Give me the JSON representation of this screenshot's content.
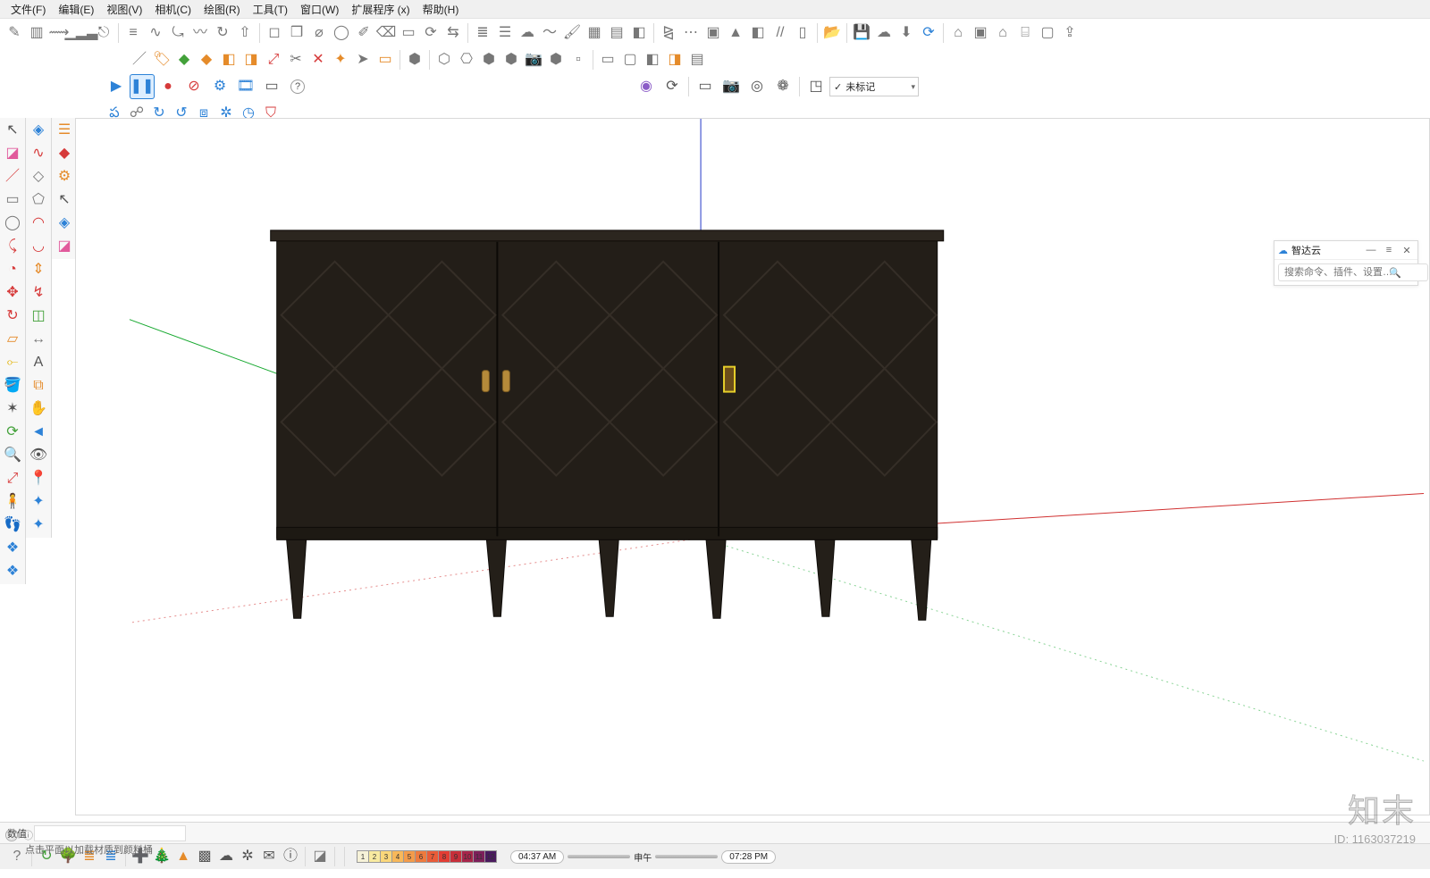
{
  "menubar": {
    "items": [
      "文件(F)",
      "编辑(E)",
      "视图(V)",
      "相机(C)",
      "绘图(R)",
      "工具(T)",
      "窗口(W)",
      "扩展程序 (x)",
      "帮助(H)"
    ]
  },
  "toolbar_row1": {
    "icons": [
      {
        "name": "pencil-icon",
        "glyph": "✎",
        "cls": "c-gray"
      },
      {
        "name": "section-plane-icon",
        "glyph": "▥",
        "cls": "c-gray"
      },
      {
        "name": "road-icon",
        "glyph": "⟿",
        "cls": "c-gray"
      },
      {
        "name": "bars-icon",
        "glyph": "▁▂▃",
        "cls": "c-gray"
      },
      {
        "name": "section-icon",
        "glyph": "⎋",
        "cls": "c-gray"
      },
      {
        "name": "ruler-icon",
        "glyph": "≡",
        "cls": "c-gray"
      },
      {
        "name": "curve-icon",
        "glyph": "∿",
        "cls": "c-gray"
      },
      {
        "name": "arc-icon",
        "glyph": "⤿",
        "cls": "c-gray"
      },
      {
        "name": "spline-icon",
        "glyph": "〰",
        "cls": "c-gray"
      },
      {
        "name": "rotate-icon",
        "glyph": "↻",
        "cls": "c-gray"
      },
      {
        "name": "extrude-icon",
        "glyph": "⇧",
        "cls": "c-gray"
      },
      {
        "name": "offset-icon",
        "glyph": "◻︎",
        "cls": "c-gray"
      },
      {
        "name": "box-icon",
        "glyph": "❒",
        "cls": "c-gray"
      },
      {
        "name": "cylinder-icon",
        "glyph": "⌀",
        "cls": "c-gray"
      },
      {
        "name": "sphere-icon",
        "glyph": "◯",
        "cls": "c-gray"
      },
      {
        "name": "draw-icon",
        "glyph": "✐",
        "cls": "c-gray"
      },
      {
        "name": "eraser-icon",
        "glyph": "⌫",
        "cls": "c-gray"
      },
      {
        "name": "select-rect-icon",
        "glyph": "▭",
        "cls": "c-gray"
      },
      {
        "name": "rotate-angle-icon",
        "glyph": "⟳",
        "cls": "c-gray"
      },
      {
        "name": "toggle-icon",
        "glyph": "⇆",
        "cls": "c-gray"
      },
      {
        "name": "layers-icon",
        "glyph": "≣",
        "cls": "c-gray"
      },
      {
        "name": "stack-icon",
        "glyph": "☰",
        "cls": "c-gray"
      },
      {
        "name": "cloud-icon",
        "glyph": "☁",
        "cls": "c-gray"
      },
      {
        "name": "wave-icon",
        "glyph": "〜",
        "cls": "c-gray"
      },
      {
        "name": "brush-icon",
        "glyph": "🖌",
        "cls": "c-gray"
      },
      {
        "name": "grid-icon",
        "glyph": "▦",
        "cls": "c-gray"
      },
      {
        "name": "align-icon",
        "glyph": "▤",
        "cls": "c-gray"
      },
      {
        "name": "eraser2-icon",
        "glyph": "◧",
        "cls": "c-gray"
      },
      {
        "name": "mirror-icon",
        "glyph": "⧎",
        "cls": "c-gray"
      },
      {
        "name": "dots-icon",
        "glyph": "⋯",
        "cls": "c-gray"
      },
      {
        "name": "group-icon",
        "glyph": "▣",
        "cls": "c-gray"
      },
      {
        "name": "triangle-icon",
        "glyph": "▲",
        "cls": "c-gray"
      },
      {
        "name": "cube-icon",
        "glyph": "◧",
        "cls": "c-gray"
      },
      {
        "name": "sweep-icon",
        "glyph": "//",
        "cls": "c-gray"
      },
      {
        "name": "frame-icon",
        "glyph": "▯",
        "cls": "c-gray"
      },
      {
        "name": "folder-open-icon",
        "glyph": "📂",
        "cls": "c-gray"
      },
      {
        "name": "save-icon",
        "glyph": "💾",
        "cls": "c-gray"
      },
      {
        "name": "upload-cloud-icon",
        "glyph": "☁︎",
        "cls": "c-gray"
      },
      {
        "name": "download-icon",
        "glyph": "⬇",
        "cls": "c-gray"
      },
      {
        "name": "refresh-icon",
        "glyph": "⟳",
        "cls": "c-blue"
      },
      {
        "name": "warehouse-icon",
        "glyph": "⌂",
        "cls": "c-gray"
      },
      {
        "name": "box3d-icon",
        "glyph": "▣",
        "cls": "c-gray"
      },
      {
        "name": "home-icon",
        "glyph": "⌂",
        "cls": "c-gray"
      },
      {
        "name": "door-icon",
        "glyph": "⌸",
        "cls": "c-gray"
      },
      {
        "name": "window-icon",
        "glyph": "▢",
        "cls": "c-gray"
      },
      {
        "name": "export-icon",
        "glyph": "⇪",
        "cls": "c-gray"
      }
    ]
  },
  "toolbar_row2": {
    "icons": [
      {
        "name": "knife-icon",
        "glyph": "／",
        "cls": "c-gray"
      },
      {
        "name": "tag-icon",
        "glyph": "🏷",
        "cls": "c-orange"
      },
      {
        "name": "diamond-icon",
        "glyph": "◆",
        "cls": "c-green"
      },
      {
        "name": "diamond2-icon",
        "glyph": "◆",
        "cls": "c-orange"
      },
      {
        "name": "cube-orange-icon",
        "glyph": "◧",
        "cls": "c-orange"
      },
      {
        "name": "cube-orange2-icon",
        "glyph": "◨",
        "cls": "c-orange"
      },
      {
        "name": "scale-icon",
        "glyph": "⤢",
        "cls": "c-red"
      },
      {
        "name": "cut-icon",
        "glyph": "✂",
        "cls": "c-gray"
      },
      {
        "name": "x-icon",
        "glyph": "✕",
        "cls": "c-red"
      },
      {
        "name": "wand-icon",
        "glyph": "✦",
        "cls": "c-orange"
      },
      {
        "name": "arrow-sel-icon",
        "glyph": "➤",
        "cls": "c-gray"
      },
      {
        "name": "doc-icon",
        "glyph": "▭",
        "cls": "c-orange"
      },
      {
        "name": "solid1-icon",
        "glyph": "⬢",
        "cls": "c-gray"
      },
      {
        "name": "solid2-icon",
        "glyph": "⬡",
        "cls": "c-gray"
      },
      {
        "name": "solid3-icon",
        "glyph": "⎔",
        "cls": "c-gray"
      },
      {
        "name": "solid4-icon",
        "glyph": "⬢",
        "cls": "c-gray"
      },
      {
        "name": "solid5-icon",
        "glyph": "⬢",
        "cls": "c-gray"
      },
      {
        "name": "camera-icon",
        "glyph": "📷",
        "cls": "c-gray"
      },
      {
        "name": "solid6-icon",
        "glyph": "⬢",
        "cls": "c-gray"
      },
      {
        "name": "page1-icon",
        "glyph": "▫",
        "cls": "c-gray"
      },
      {
        "name": "page2-icon",
        "glyph": "▭",
        "cls": "c-gray"
      },
      {
        "name": "page3-icon",
        "glyph": "▢",
        "cls": "c-gray"
      },
      {
        "name": "page4-icon",
        "glyph": "◧",
        "cls": "c-gray"
      },
      {
        "name": "page5-icon",
        "glyph": "◨",
        "cls": "c-orange"
      },
      {
        "name": "page6-icon",
        "glyph": "▤",
        "cls": "c-gray"
      }
    ]
  },
  "toolbar_row3": {
    "play": {
      "name": "play-icon",
      "glyph": "▶",
      "cls": "c-blue"
    },
    "pause": {
      "name": "pause-icon",
      "glyph": "❚❚",
      "cls": "c-blue"
    },
    "record": {
      "name": "record-icon",
      "glyph": "●",
      "cls": "c-red"
    },
    "stop": {
      "name": "stop-icon",
      "glyph": "⊘",
      "cls": "c-red"
    },
    "gear": {
      "name": "gear-icon",
      "glyph": "⚙",
      "cls": "c-blue"
    },
    "film": {
      "name": "film-icon",
      "glyph": "🎞",
      "cls": "c-blue"
    },
    "screen": {
      "name": "screen-icon",
      "glyph": "▭",
      "cls": "c-gray"
    },
    "help": {
      "name": "help-icon",
      "glyph": "?",
      "cls": "c-gray"
    },
    "pin": {
      "name": "pin-icon",
      "glyph": "◉",
      "cls": "c-purple"
    },
    "refresh": {
      "name": "refresh2-icon",
      "glyph": "⟳",
      "cls": "c-gray"
    },
    "screen2": {
      "name": "screen2-icon",
      "glyph": "▭",
      "cls": "c-gray"
    },
    "camera": {
      "name": "camera2-icon",
      "glyph": "📷",
      "cls": "c-gray"
    },
    "target": {
      "name": "target-icon",
      "glyph": "◎",
      "cls": "c-gray"
    },
    "globe": {
      "name": "globe-icon",
      "glyph": "❁",
      "cls": "c-gray"
    },
    "box": {
      "name": "box-dropdown-icon",
      "glyph": "◳",
      "cls": "c-gray"
    },
    "tag_label": "未标记",
    "tag_prefix": "✓"
  },
  "toolbar_row4": {
    "icons": [
      {
        "name": "cloud-sync-icon",
        "glyph": "ప",
        "cls": "c-blue"
      },
      {
        "name": "person-search-icon",
        "glyph": "☍",
        "cls": "c-gray"
      },
      {
        "name": "cloud-up-icon",
        "glyph": "↻",
        "cls": "c-blue"
      },
      {
        "name": "cloud-down-icon",
        "glyph": "↺",
        "cls": "c-blue"
      },
      {
        "name": "square-bracket-icon",
        "glyph": "⧈",
        "cls": "c-blue"
      },
      {
        "name": "gear-cloud-icon",
        "glyph": "✲",
        "cls": "c-blue"
      },
      {
        "name": "schedule-icon",
        "glyph": "◷",
        "cls": "c-blue"
      },
      {
        "name": "shield-icon",
        "glyph": "⛉",
        "cls": "c-red"
      }
    ]
  },
  "left_colA": [
    {
      "name": "select-icon",
      "glyph": "↖",
      "cls": ""
    },
    {
      "name": "eraser-pink-icon",
      "glyph": "◪",
      "cls": "c-pink"
    },
    {
      "name": "line-red-icon",
      "glyph": "／",
      "cls": "c-red"
    },
    {
      "name": "rect-gray-icon",
      "glyph": "▭",
      "cls": "c-gray"
    },
    {
      "name": "circle-gray-icon",
      "glyph": "◯",
      "cls": "c-gray"
    },
    {
      "name": "arc-red-icon",
      "glyph": "⤹",
      "cls": "c-red"
    },
    {
      "name": "pie-red-icon",
      "glyph": "◔",
      "cls": "c-red"
    },
    {
      "name": "move-red-icon",
      "glyph": "✥",
      "cls": "c-red"
    },
    {
      "name": "rotate-red-icon",
      "glyph": "↻",
      "cls": "c-red"
    },
    {
      "name": "offset-yellow-icon",
      "glyph": "▱",
      "cls": "c-orange"
    },
    {
      "name": "tape-yellow-icon",
      "glyph": "⟜",
      "cls": "c-yellow"
    },
    {
      "name": "paint-yellow-icon",
      "glyph": "🪣",
      "cls": "c-yellow"
    },
    {
      "name": "axis-icon",
      "glyph": "✶",
      "cls": ""
    },
    {
      "name": "orbit-green-icon",
      "glyph": "⟳",
      "cls": "c-green"
    },
    {
      "name": "zoom-icon",
      "glyph": "🔍",
      "cls": ""
    },
    {
      "name": "zoom-extents-icon",
      "glyph": "⤢",
      "cls": "c-red"
    },
    {
      "name": "walk-icon",
      "glyph": "🧍",
      "cls": ""
    },
    {
      "name": "footprint-icon",
      "glyph": "👣",
      "cls": ""
    },
    {
      "name": "extension1-icon",
      "glyph": "❖",
      "cls": "c-blue"
    },
    {
      "name": "extension2-icon",
      "glyph": "❖",
      "cls": "c-blue"
    }
  ],
  "left_colB": [
    {
      "name": "component-icon",
      "glyph": "◈",
      "cls": "c-blue"
    },
    {
      "name": "s-curve-red-icon",
      "glyph": "∿",
      "cls": "c-red"
    },
    {
      "name": "rect-rot-icon",
      "glyph": "◇",
      "cls": "c-gray"
    },
    {
      "name": "polygon-icon",
      "glyph": "⬠",
      "cls": "c-gray"
    },
    {
      "name": "arc2-red-icon",
      "glyph": "◠",
      "cls": "c-red"
    },
    {
      "name": "arc3-red-icon",
      "glyph": "◡",
      "cls": "c-red"
    },
    {
      "name": "pushpull-icon",
      "glyph": "⇕",
      "cls": "c-orange"
    },
    {
      "name": "follow-me-icon",
      "glyph": "↯",
      "cls": "c-red"
    },
    {
      "name": "scale-green-icon",
      "glyph": "◫",
      "cls": "c-green"
    },
    {
      "name": "dim-icon",
      "glyph": "↔",
      "cls": "c-gray"
    },
    {
      "name": "text-icon",
      "glyph": "A",
      "cls": ""
    },
    {
      "name": "section2-icon",
      "glyph": "⧉",
      "cls": "c-orange"
    },
    {
      "name": "pan-icon",
      "glyph": "✋",
      "cls": ""
    },
    {
      "name": "prev-view-icon",
      "glyph": "◄",
      "cls": "c-blue"
    },
    {
      "name": "look-icon",
      "glyph": "👁",
      "cls": ""
    },
    {
      "name": "position-cam-icon",
      "glyph": "📍",
      "cls": ""
    },
    {
      "name": "extension3-icon",
      "glyph": "✦",
      "cls": "c-blue"
    },
    {
      "name": "extension4-icon",
      "glyph": "✦",
      "cls": "c-blue"
    }
  ],
  "left_colC": [
    {
      "name": "stack-orange-icon",
      "glyph": "☰",
      "cls": "c-orange"
    },
    {
      "name": "box-red-icon",
      "glyph": "◆",
      "cls": "c-red"
    },
    {
      "name": "gear-orange-icon",
      "glyph": "⚙",
      "cls": "c-orange"
    },
    {
      "name": "select2-icon",
      "glyph": "↖",
      "cls": ""
    },
    {
      "name": "cube-blue-icon",
      "glyph": "◈",
      "cls": "c-blue"
    },
    {
      "name": "pink-eraser-icon",
      "glyph": "◪",
      "cls": "c-pink"
    }
  ],
  "side_panel": {
    "cloud_icon": "☁",
    "title": "智达云",
    "min": "—",
    "menu": "≡",
    "close": "✕",
    "search_placeholder": "搜索命令、插件、设置…"
  },
  "status": {
    "label": "数值",
    "value": ""
  },
  "bottom": {
    "icons": [
      {
        "name": "help2-icon",
        "glyph": "?",
        "cls": "c-gray"
      },
      {
        "name": "cloud-green-icon",
        "glyph": "↻",
        "cls": "c-green"
      },
      {
        "name": "tree-green-icon",
        "glyph": "🌳",
        "cls": "c-green"
      },
      {
        "name": "layers-orange-icon",
        "glyph": "≣",
        "cls": "c-orange"
      },
      {
        "name": "layers-blue-icon",
        "glyph": "≣",
        "cls": "c-blue"
      },
      {
        "name": "plus-icon",
        "glyph": "➕",
        "cls": ""
      },
      {
        "name": "tree2-icon",
        "glyph": "🎄",
        "cls": "c-green"
      },
      {
        "name": "sun-orange-icon",
        "glyph": "▲",
        "cls": "c-orange"
      },
      {
        "name": "checker-icon",
        "glyph": "▩",
        "cls": ""
      },
      {
        "name": "cloud-up2-icon",
        "glyph": "☁",
        "cls": ""
      },
      {
        "name": "gear2-icon",
        "glyph": "✲",
        "cls": ""
      },
      {
        "name": "mail-icon",
        "glyph": "✉",
        "cls": ""
      },
      {
        "name": "info2-icon",
        "glyph": "ⓘ",
        "cls": ""
      },
      {
        "name": "eraser-gray-icon",
        "glyph": "◪",
        "cls": "c-gray"
      }
    ],
    "swatches": [
      {
        "n": "1",
        "c": "#f6f2d8"
      },
      {
        "n": "2",
        "c": "#f8eaa0"
      },
      {
        "n": "3",
        "c": "#fbd77a"
      },
      {
        "n": "4",
        "c": "#f7b85a"
      },
      {
        "n": "5",
        "c": "#f39b4a"
      },
      {
        "n": "6",
        "c": "#ee7a3e"
      },
      {
        "n": "7",
        "c": "#e95b38"
      },
      {
        "n": "8",
        "c": "#e33d34"
      },
      {
        "n": "9",
        "c": "#c72f3a"
      },
      {
        "n": "10",
        "c": "#a8254a"
      },
      {
        "n": "11",
        "c": "#7d1f5a"
      },
      {
        "n": "12",
        "c": "#4a1a5e"
      }
    ],
    "time_left": "04:37 AM",
    "time_mid": "申午",
    "time_right": "07:28 PM"
  },
  "hint": {
    "info_glyph": "ⓘ",
    "text": "点击平面以加载材质到颜料桶"
  },
  "watermark": {
    "brand": "知末",
    "id": "ID: 1163037219"
  }
}
